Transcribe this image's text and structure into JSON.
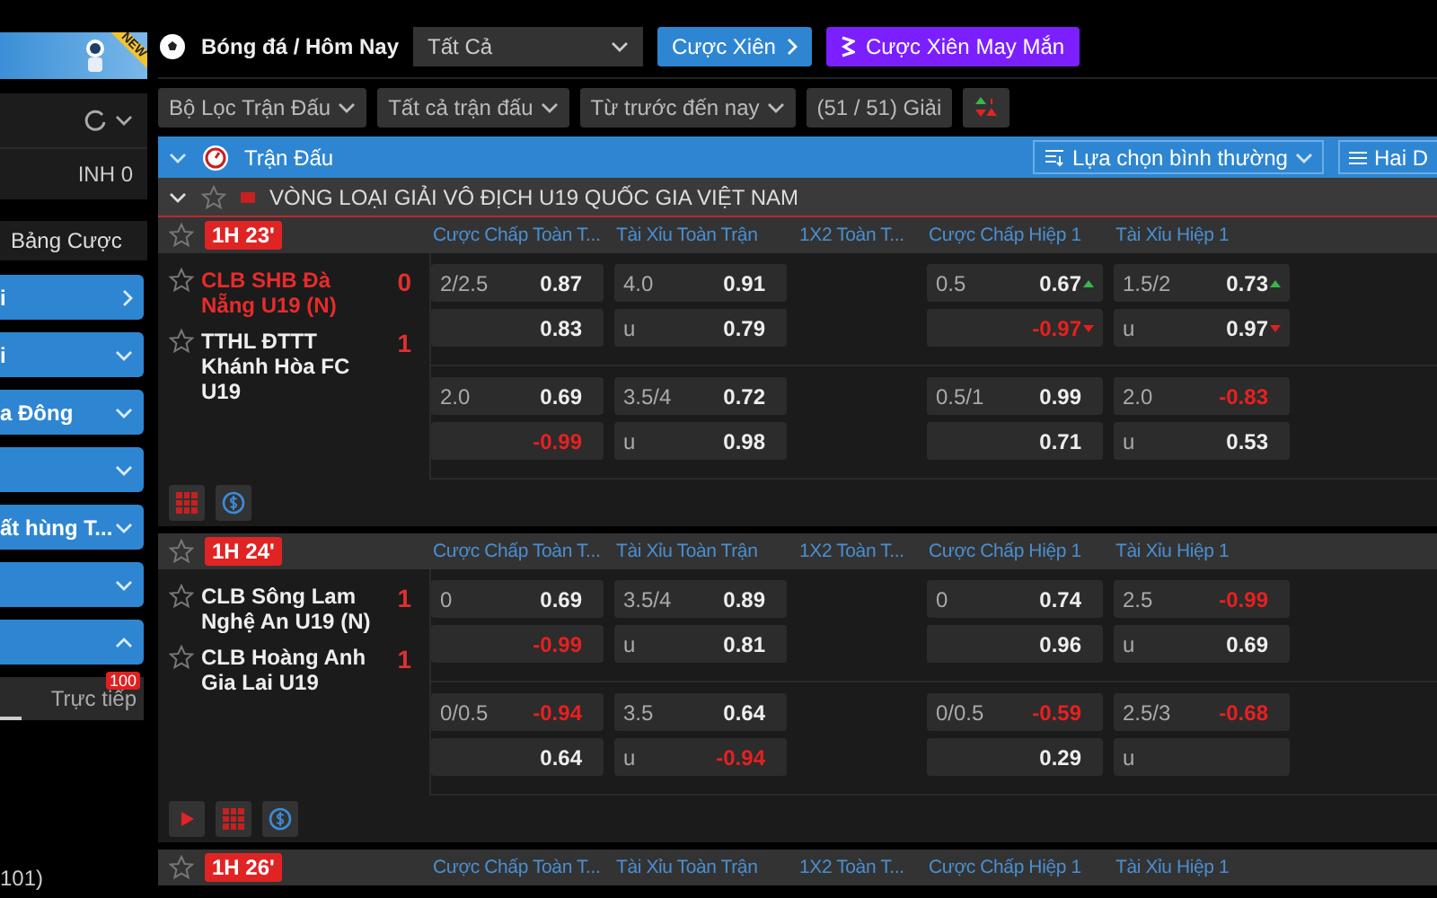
{
  "sidebar": {
    "banner": {
      "badge": "NEW"
    },
    "balance": "INH 0",
    "section_title": "Bảng Cược",
    "menu": [
      {
        "label": "i",
        "kind": "arrow"
      },
      {
        "label": "i",
        "expanded": false,
        "kind": "chevron"
      },
      {
        "label": "a Đông",
        "expanded": false,
        "kind": "chevron"
      },
      {
        "expanded": false,
        "kind": "chevron"
      },
      {
        "label": "ất hùng T...",
        "expanded": false,
        "kind": "chevron"
      },
      {
        "expanded": false,
        "kind": "chevron"
      },
      {
        "expanded": true,
        "kind": "chevron"
      }
    ],
    "live_tab": {
      "label": "Trực tiếp",
      "badge": "100"
    },
    "footer": "101)"
  },
  "toolbar": {
    "sport": "Bóng đá / Hôm Nay",
    "dropdown": "Tất Cả",
    "parlay_button": "Cược Xiên",
    "lucky_button": "Cược Xiên May Mắn"
  },
  "filters": [
    {
      "label": "Bộ Lọc Trận Đấu",
      "kind": "dropdown"
    },
    {
      "label": "Tất cả trận đấu",
      "kind": "dropdown"
    },
    {
      "label": "Từ trước đến nay",
      "kind": "dropdown"
    },
    {
      "label": "(51 / 51) Giải",
      "kind": "plain"
    },
    {
      "kind": "sort"
    }
  ],
  "section_bar": {
    "title": "Trận Đấu",
    "view_select": "Lựa chọn bình thường",
    "mode_button": "Hai D"
  },
  "league": {
    "name": "VÒNG LOẠI GIẢI VÔ ĐỊCH U19 QUỐC GIA VIỆT NAM"
  },
  "matches": [
    {
      "time": "1H 23'",
      "headers": [
        "Cược Chấp Toàn T...",
        "Tài Xỉu Toàn Trận",
        "1X2 Toàn T...",
        "Cược Chấp Hiệp 1",
        "Tài Xỉu Hiệp 1"
      ],
      "teams": [
        {
          "name": "CLB SHB Đà Nẵng U19 (N)",
          "score": "0",
          "highlighted": true
        },
        {
          "name": "TTHL ĐTTT Khánh Hòa FC U19",
          "score": "1",
          "highlighted": false
        }
      ],
      "line_sets": [
        {
          "handicap_ft": [
            {
              "line": "2/2.5",
              "odds": "0.87",
              "negative": false
            },
            {
              "odds": "0.83",
              "negative": false
            }
          ],
          "over_under_ft": [
            {
              "line": "4.0",
              "odds": "0.91",
              "negative": false
            },
            {
              "line": "u",
              "odds": "0.79",
              "negative": false
            }
          ],
          "handicap_1h": [
            {
              "line": "0.5",
              "odds": "0.67",
              "negative": false,
              "odds_up": true
            },
            {
              "odds": "-0.97",
              "negative": true,
              "odds_down": true
            }
          ],
          "over_under_1h": [
            {
              "line": "1.5/2",
              "odds": "0.73",
              "negative": false,
              "odds_up": true
            },
            {
              "line": "u",
              "odds": "0.97",
              "negative": false,
              "odds_down": true
            }
          ]
        },
        {
          "handicap_ft": [
            {
              "line": "2.0",
              "odds": "0.69",
              "negative": false
            },
            {
              "odds": "-0.99",
              "negative": true
            }
          ],
          "over_under_ft": [
            {
              "line": "3.5/4",
              "odds": "0.72",
              "negative": false
            },
            {
              "line": "u",
              "odds": "0.98",
              "negative": false
            }
          ],
          "handicap_1h": [
            {
              "line": "0.5/1",
              "odds": "0.99",
              "negative": false
            },
            {
              "odds": "0.71",
              "negative": false
            }
          ],
          "over_under_1h": [
            {
              "line": "2.0",
              "odds": "-0.83",
              "negative": true
            },
            {
              "line": "u",
              "odds": "0.53",
              "negative": false
            }
          ]
        }
      ],
      "live_stream": false
    },
    {
      "time": "1H 24'",
      "headers": [
        "Cược Chấp Toàn T...",
        "Tài Xỉu Toàn Trận",
        "1X2 Toàn T...",
        "Cược Chấp Hiệp 1",
        "Tài Xỉu Hiệp 1"
      ],
      "teams": [
        {
          "name": "CLB Sông Lam Nghệ An U19 (N)",
          "score": "1",
          "highlighted": false
        },
        {
          "name": "CLB Hoàng Anh Gia Lai U19",
          "score": "1",
          "highlighted": false
        }
      ],
      "line_sets": [
        {
          "handicap_ft": [
            {
              "line": "0",
              "odds": "0.69",
              "negative": false
            },
            {
              "odds": "-0.99",
              "negative": true
            }
          ],
          "over_under_ft": [
            {
              "line": "3.5/4",
              "odds": "0.89",
              "negative": false
            },
            {
              "line": "u",
              "odds": "0.81",
              "negative": false
            }
          ],
          "handicap_1h": [
            {
              "line": "0",
              "odds": "0.74",
              "negative": false
            },
            {
              "odds": "0.96",
              "negative": false
            }
          ],
          "over_under_1h": [
            {
              "line": "2.5",
              "odds": "-0.99",
              "negative": true
            },
            {
              "line": "u",
              "odds": "0.69",
              "negative": false
            }
          ]
        },
        {
          "handicap_ft": [
            {
              "line": "0/0.5",
              "odds": "-0.94",
              "negative": true
            },
            {
              "odds": "0.64",
              "negative": false
            }
          ],
          "over_under_ft": [
            {
              "line": "3.5",
              "odds": "0.64",
              "negative": false
            },
            {
              "line": "u",
              "odds": "-0.94",
              "negative": true
            }
          ],
          "handicap_1h": [
            {
              "line": "0/0.5",
              "odds": "-0.59",
              "negative": true
            },
            {
              "odds": "0.29",
              "negative": false
            }
          ],
          "over_under_1h": [
            {
              "line": "2.5/3",
              "odds": "-0.68",
              "negative": true
            },
            {
              "line": "u"
            }
          ]
        }
      ],
      "live_stream": true
    },
    {
      "time": "1H 26'",
      "headers": [
        "Cược Chấp Toàn T...",
        "Tài Xỉu Toàn Trận",
        "1X2 Toàn T...",
        "Cược Chấp Hiệp 1",
        "Tài Xỉu Hiệp 1"
      ]
    }
  ]
}
